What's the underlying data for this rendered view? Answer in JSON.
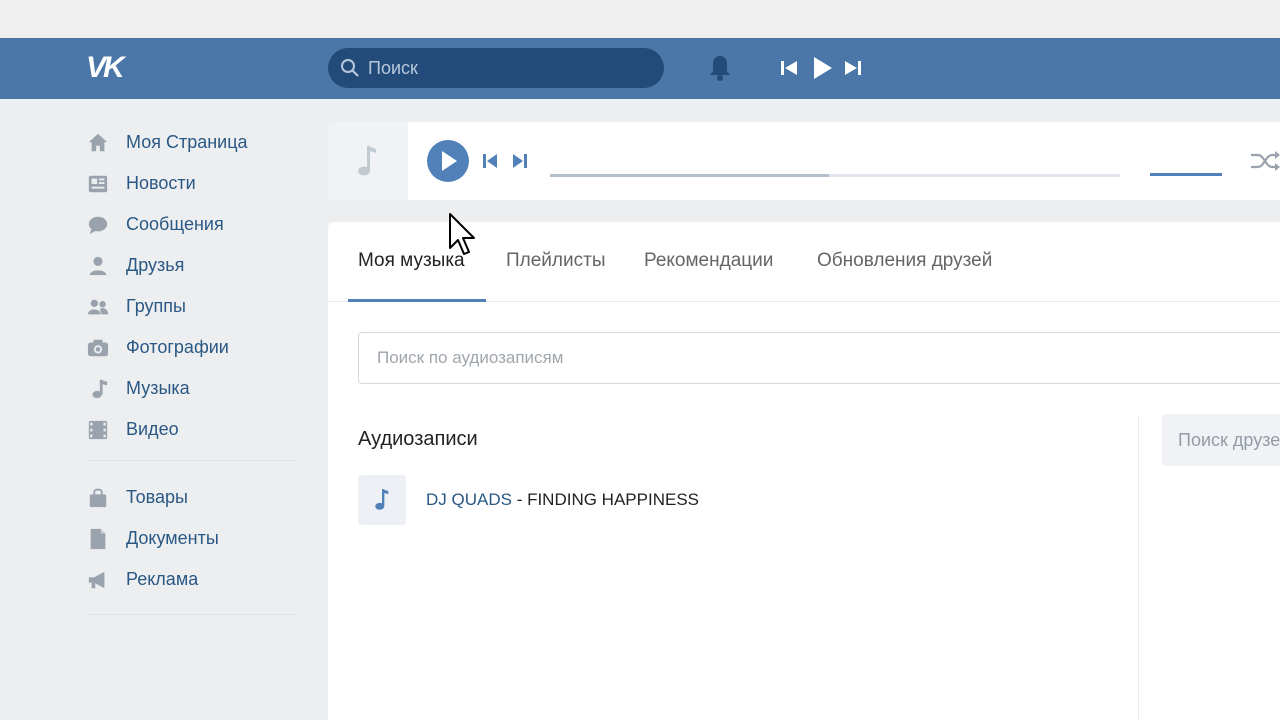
{
  "header": {
    "logo": "VK",
    "search_placeholder": "Поиск"
  },
  "sidebar": {
    "items": [
      {
        "label": "Моя Страница",
        "icon": "home-icon"
      },
      {
        "label": "Новости",
        "icon": "news-icon"
      },
      {
        "label": "Сообщения",
        "icon": "messages-icon"
      },
      {
        "label": "Друзья",
        "icon": "friend-icon"
      },
      {
        "label": "Группы",
        "icon": "groups-icon"
      },
      {
        "label": "Фотографии",
        "icon": "camera-icon"
      },
      {
        "label": "Музыка",
        "icon": "music-note-icon"
      },
      {
        "label": "Видео",
        "icon": "video-film-icon"
      }
    ],
    "secondary_items": [
      {
        "label": "Товары",
        "icon": "shopping-bag-icon"
      },
      {
        "label": "Документы",
        "icon": "document-icon"
      },
      {
        "label": "Реклама",
        "icon": "megaphone-icon"
      }
    ]
  },
  "player": {
    "progress": 0.49
  },
  "tabs": [
    {
      "label": "Моя музыка",
      "active": true
    },
    {
      "label": "Плейлисты",
      "active": false
    },
    {
      "label": "Рекомендации",
      "active": false
    },
    {
      "label": "Обновления друзей",
      "active": false
    }
  ],
  "audio_search_placeholder": "Поиск по аудиозаписям",
  "section_title": "Аудиозаписи",
  "tracks": [
    {
      "artist": "DJ QUADS",
      "separator": " - ",
      "title": "FINDING HAPPINESS"
    }
  ],
  "friend_search_placeholder": "Поиск друзей",
  "colors": {
    "header": "#4a76a8",
    "accent": "#5181b8",
    "link": "#2a5885",
    "background": "#edeef0"
  }
}
